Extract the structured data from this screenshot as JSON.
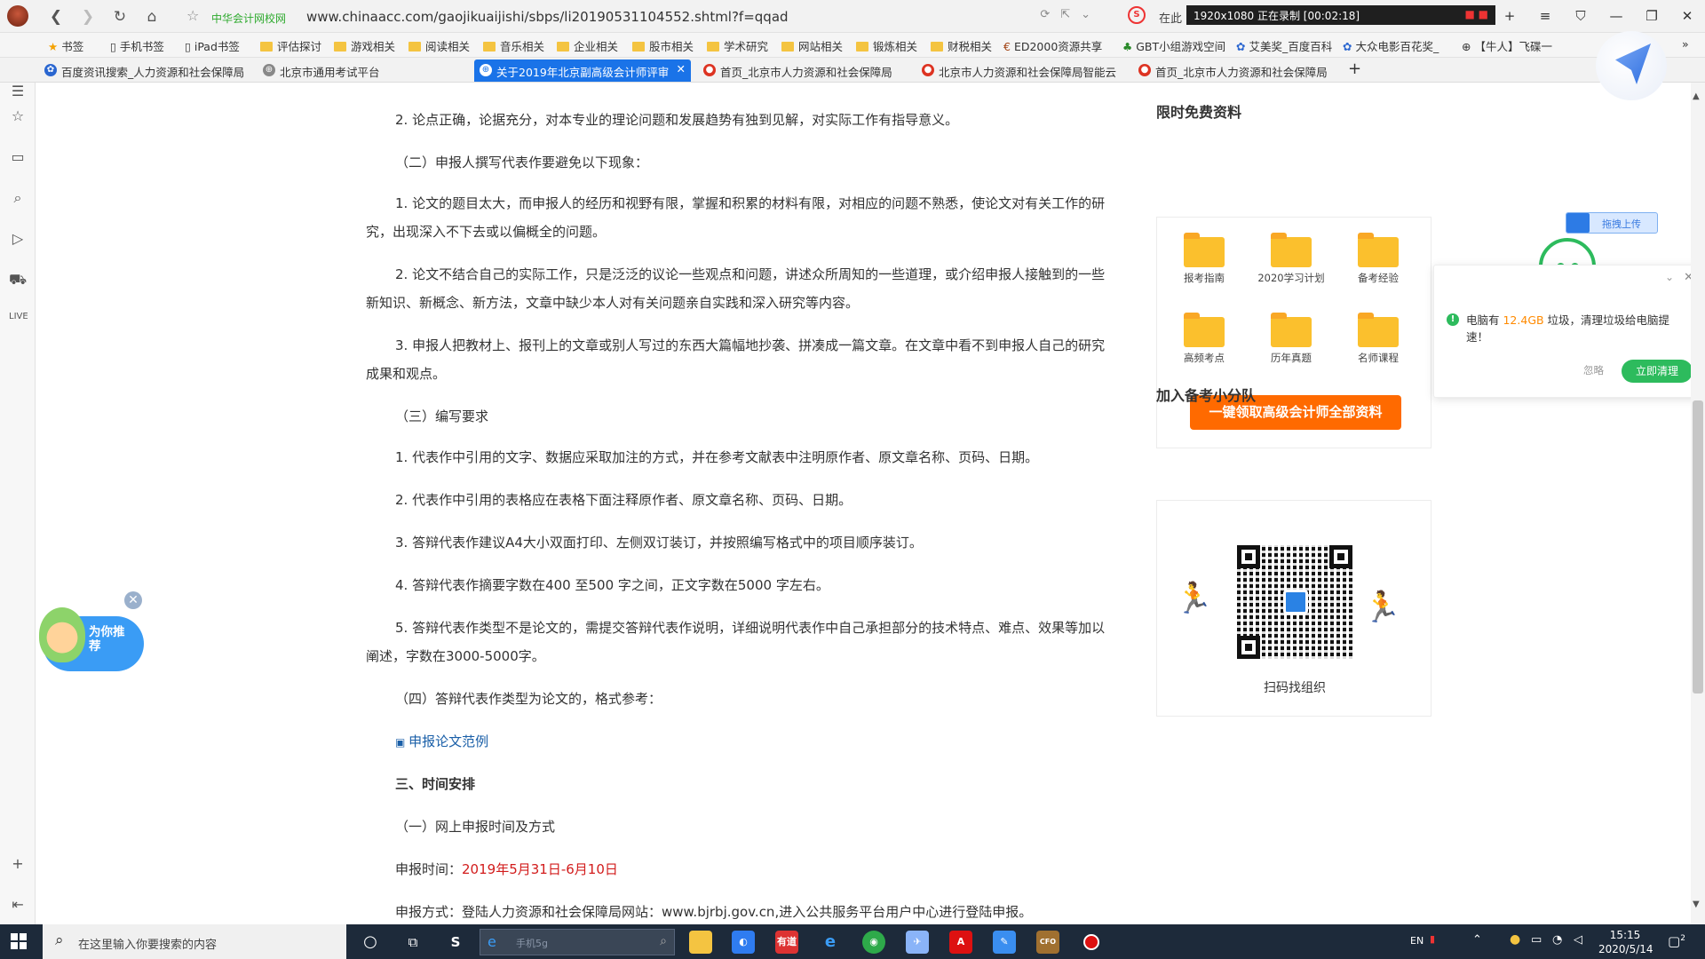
{
  "browser": {
    "site_label": "中华会计网校网",
    "url": "www.chinaacc.com/gaojikuaijishi/sbps/li20190531104552.shtml?f=qqad",
    "search_prefix": "在此",
    "recorder": "1920x1080  正在录制 [00:02:18]",
    "win_controls": [
      "+",
      "≡",
      "⛉",
      "—",
      "❐",
      "✕"
    ]
  },
  "bookmarks": [
    {
      "label": "书签",
      "icon": "star-icon"
    },
    {
      "label": "手机书签",
      "icon": "phone-icon"
    },
    {
      "label": "iPad书签",
      "icon": "tablet-icon"
    },
    {
      "label": "评估探讨",
      "icon": "folder-icon"
    },
    {
      "label": "游戏相关",
      "icon": "folder-icon"
    },
    {
      "label": "阅读相关",
      "icon": "folder-icon"
    },
    {
      "label": "音乐相关",
      "icon": "folder-icon"
    },
    {
      "label": "企业相关",
      "icon": "folder-icon"
    },
    {
      "label": "股市相关",
      "icon": "folder-icon"
    },
    {
      "label": "学术研究",
      "icon": "folder-icon"
    },
    {
      "label": "网站相关",
      "icon": "folder-icon"
    },
    {
      "label": "锻炼相关",
      "icon": "folder-icon"
    },
    {
      "label": "财税相关",
      "icon": "folder-icon"
    },
    {
      "label": "ED2000资源共享",
      "icon": "ed-icon"
    },
    {
      "label": "GBT小组游戏空间",
      "icon": "tree-icon"
    },
    {
      "label": "艾美奖_百度百科",
      "icon": "baidu-icon"
    },
    {
      "label": "大众电影百花奖_",
      "icon": "baidu-icon"
    },
    {
      "label": "【牛人】飞碟一",
      "icon": "globe-icon"
    }
  ],
  "tabs": [
    {
      "label": "百度资讯搜索_人力资源和社会保障局",
      "active": false
    },
    {
      "label": "北京市通用考试平台",
      "active": false
    },
    {
      "label": "关于2019年北京副高级会计师评审",
      "active": true
    },
    {
      "label": "首页_北京市人力资源和社会保障局",
      "active": false
    },
    {
      "label": "北京市人力资源和社会保障局智能云",
      "active": false
    },
    {
      "label": "首页_北京市人力资源和社会保障局",
      "active": false
    }
  ],
  "article": {
    "p1": "2. 论点正确，论据充分，对本专业的理论问题和发展趋势有独到见解，对实际工作有指导意义。",
    "h2": "（二）申报人撰写代表作要避免以下现象：",
    "p2": "1. 论文的题目太大，而申报人的经历和视野有限，掌握和积累的材料有限，对相应的问题不熟悉，使论文对有关工作的研究，出现深入不下去或以偏概全的问题。",
    "p3": "2. 论文不结合自己的实际工作，只是泛泛的议论一些观点和问题，讲述众所周知的一些道理，或介绍申报人接触到的一些新知识、新概念、新方法，文章中缺少本人对有关问题亲自实践和深入研究等内容。",
    "p4": "3. 申报人把教材上、报刊上的文章或别人写过的东西大篇幅地抄袭、拼凑成一篇文章。在文章中看不到申报人自己的研究成果和观点。",
    "h3": "（三）编写要求",
    "p5": "1. 代表作中引用的文字、数据应采取加注的方式，并在参考文献表中注明原作者、原文章名称、页码、日期。",
    "p6": "2. 代表作中引用的表格应在表格下面注释原作者、原文章名称、页码、日期。",
    "p7": "3. 答辩代表作建议A4大小双面打印、左侧双订装订，并按照编写格式中的项目顺序装订。",
    "p8": "4. 答辩代表作摘要字数在400 至500 字之间，正文字数在5000 字左右。",
    "p9": "5. 答辩代表作类型不是论文的，需提交答辩代表作说明，详细说明代表作中自己承担部分的技术特点、难点、效果等加以阐述，字数在3000-5000字。",
    "h4": "（四）答辩代表作类型为论文的，格式参考：",
    "link": "申报论文范例",
    "sec3": "三、时间安排",
    "h5": "（一）网上申报时间及方式",
    "time_label": "申报时间：",
    "time_value": "2019年5月31日-6月10日",
    "method": "申报方式：登陆人力资源和社会保障局网站：www.bjrbj.gov.cn,进入公共服务平台用户中心进行登陆申报。"
  },
  "sidebar": {
    "free_title": "限时免费资料",
    "items": [
      "报考指南",
      "2020学习计划",
      "备考经验",
      "高频考点",
      "历年真题",
      "名师课程"
    ],
    "get_button": "一键领取高级会计师全部资料",
    "team_title": "加入备考小分队",
    "qr_caption": "扫码找组织"
  },
  "mascot": {
    "text": "为你推荐",
    "close": "✕"
  },
  "upload_button": "拖拽上传",
  "popup": {
    "pre": "电脑有 ",
    "size": "12.4GB",
    "post": " 垃圾，清理垃圾给电脑提速！",
    "ignore": "忽略",
    "clean": "立即清理"
  },
  "taskbar": {
    "search_placeholder": "在这里输入你要搜索的内容",
    "mini_search": "手机5g",
    "lang": "EN",
    "time": "15:15",
    "date": "2020/5/14",
    "notify_count": "2"
  },
  "colors": {
    "accent": "#1a73e8",
    "orange": "#ff6a00",
    "green": "#2dbb5d",
    "red": "#d21c1c"
  }
}
